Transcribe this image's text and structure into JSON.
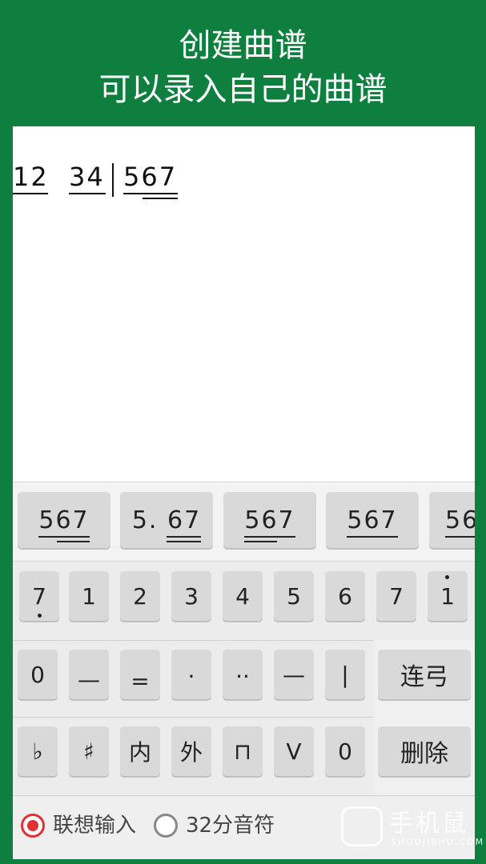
{
  "header": {
    "title": "创建曲谱",
    "subtitle": "可以录入自己的曲谱"
  },
  "score": {
    "group1": "12",
    "group2": "34",
    "group3": "567"
  },
  "suggestions": [
    "567",
    "5. 67",
    "567",
    "567",
    "56"
  ],
  "note_keys": [
    "7",
    "1",
    "2",
    "3",
    "4",
    "5",
    "6",
    "7",
    "1"
  ],
  "symbol_keys": [
    "0",
    "—",
    "=",
    "·",
    "··",
    "—",
    "|"
  ],
  "modifier_keys": [
    "♭",
    "♯",
    "内",
    "外",
    "⊓",
    "V",
    "0"
  ],
  "actions": {
    "slur": "连弓",
    "delete": "删除"
  },
  "options": {
    "associative_label": "联想输入",
    "thirtysecond_label": "32分音符"
  },
  "watermark": {
    "main": "手机鼠",
    "sub": "SHOUJISHU.COM"
  },
  "colors": {
    "brand_green": "#0f7f3f",
    "radio_active": "#e03030"
  }
}
